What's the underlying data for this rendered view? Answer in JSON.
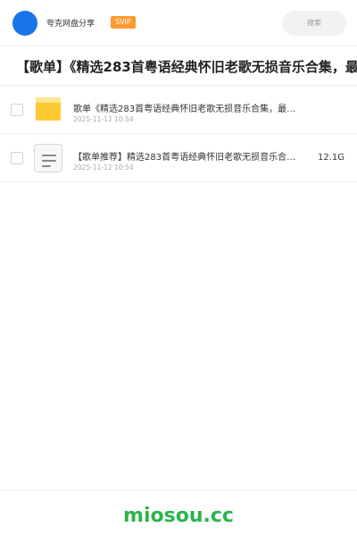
{
  "header": {
    "username": "夸克网盘分享",
    "vip_badge": "SVIP",
    "search_placeholder": "搜索"
  },
  "page": {
    "title": "【歌单】《精选283首粤语经典怀旧老歌无损音乐合集，最"
  },
  "files": [
    {
      "icon": "folder-icon",
      "name": "歌单《精选283首粤语经典怀旧老歌无损音乐合集，最…",
      "date": "2025-11-12 10:54",
      "size": ""
    },
    {
      "icon": "document-icon",
      "name": "【歌单推荐】精选283首粤语经典怀旧老歌无损音乐合…",
      "date": "2025-11-12 10:54",
      "size": "12.1G"
    }
  ],
  "footer": {
    "brand": "miosou.cc"
  },
  "colors": {
    "avatar": "#1a73e8",
    "vip": "#ff9a2e",
    "folder": "#ffc933",
    "brand": "#2db34a"
  }
}
